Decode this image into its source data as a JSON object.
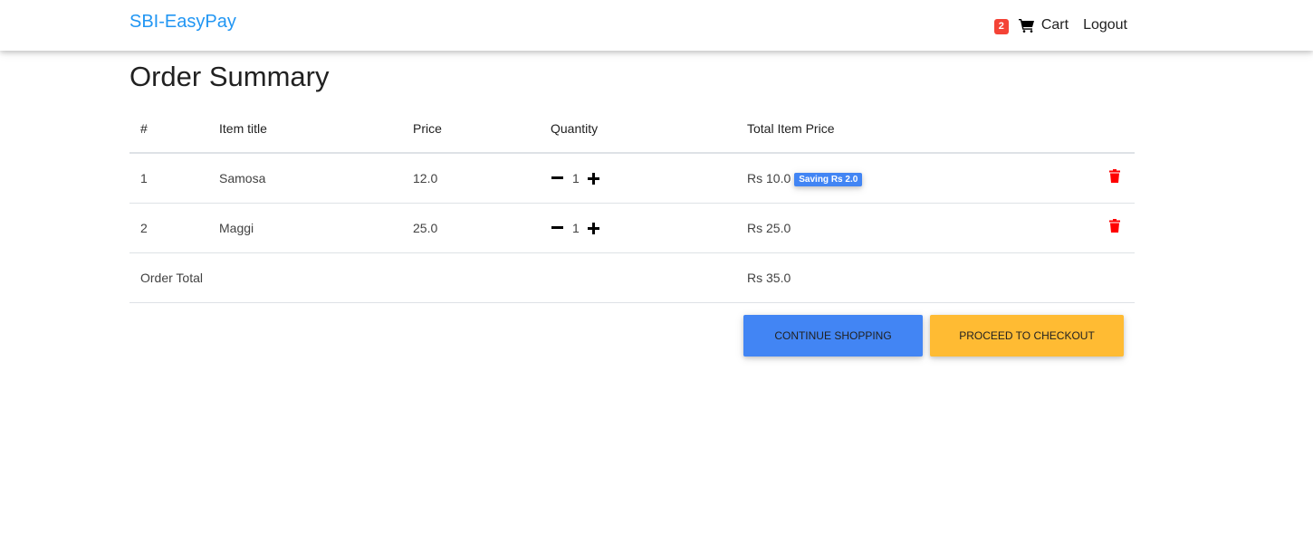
{
  "header": {
    "brand": "SBI-EasyPay",
    "cart_count": "2",
    "cart_label": "Cart",
    "logout_label": "Logout"
  },
  "page": {
    "title": "Order Summary"
  },
  "table": {
    "columns": [
      "#",
      "Item title",
      "Price",
      "Quantity",
      "Total Item Price"
    ],
    "rows": [
      {
        "num": "1",
        "title": "Samosa",
        "price": "12.0",
        "qty": "1",
        "total": "Rs 10.0",
        "saving": "Saving Rs 2.0"
      },
      {
        "num": "2",
        "title": "Maggi",
        "price": "25.0",
        "qty": "1",
        "total": "Rs 25.0",
        "saving": ""
      }
    ],
    "order_total_label": "Order Total",
    "order_total_value": "Rs 35.0"
  },
  "actions": {
    "continue_label": "Continue shopping",
    "checkout_label": "Proceed to checkout"
  },
  "icons": {
    "cart": "shopping-cart-icon",
    "minus": "minus-icon",
    "plus": "plus-icon",
    "delete": "trash-icon"
  },
  "colors": {
    "brand": "#2196f3",
    "badge": "#f44336",
    "saving_badge": "#4285f4",
    "delete_icon": "#ff0000",
    "continue_button": "#4285f4",
    "checkout_button": "#ffbb33"
  }
}
